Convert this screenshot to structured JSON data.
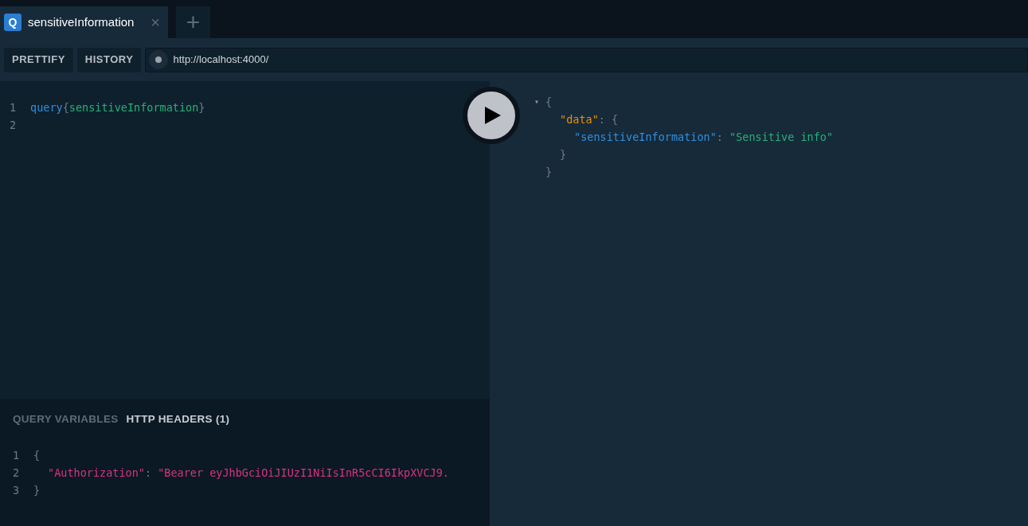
{
  "tabs": [
    {
      "badge": "Q",
      "label": "sensitiveInformation",
      "close": "×",
      "selected": true
    }
  ],
  "new_tab": "+",
  "toolbar": {
    "buttons": [
      "PRETTIFY",
      "HISTORY"
    ],
    "url": "http://localhost:4000/"
  },
  "query_editor": {
    "lines": [
      {
        "number": "1",
        "tokens": [
          {
            "text": "query",
            "kind": "keyword"
          },
          {
            "text": "{",
            "kind": "punct"
          },
          {
            "text": "sensitiveInformation",
            "kind": "field"
          },
          {
            "text": "}",
            "kind": "punct"
          }
        ]
      },
      {
        "number": "2"
      }
    ]
  },
  "bottom_panel": {
    "tabs": [
      {
        "label": "QUERY VARIABLES",
        "selected": false
      },
      {
        "label": "HTTP HEADERS (1)",
        "selected": true
      }
    ],
    "lines": [
      {
        "number": "1",
        "kind": "outer",
        "tokens": [
          {
            "text": "{",
            "kind": "punct"
          }
        ]
      },
      {
        "number": "2",
        "kind": "inner",
        "tokens": [
          {
            "text": "\"Authorization\"",
            "kind": "header"
          },
          {
            "text": ": ",
            "kind": "punct"
          },
          {
            "text": "\"Bearer eyJhbGciOiJIUzI1NiIsInR5cCI6IkpXVCJ9.",
            "kind": "header"
          }
        ]
      },
      {
        "number": "3",
        "kind": "outer",
        "tokens": [
          {
            "text": "}",
            "kind": "punct"
          }
        ]
      }
    ]
  },
  "result": {
    "lines": [
      {
        "fold": "▾",
        "kind": "outer",
        "tokens": [
          {
            "text": "{",
            "kind": "punct"
          }
        ]
      },
      {
        "kind": "inner",
        "tokens": [
          {
            "text": "\"data\"",
            "kind": "key"
          },
          {
            "text": ": {",
            "kind": "punct"
          }
        ]
      },
      {
        "kind": "deep",
        "tokens": [
          {
            "text": "\"sensitiveInformation\"",
            "kind": "prop"
          },
          {
            "text": ": ",
            "kind": "punct"
          },
          {
            "text": "\"Sensitive info\"",
            "kind": "string"
          }
        ]
      },
      {
        "kind": "inner",
        "tokens": [
          {
            "text": "}",
            "kind": "punct"
          }
        ]
      },
      {
        "kind": "outer",
        "tokens": [
          {
            "text": "}",
            "kind": "punct"
          }
        ]
      }
    ]
  }
}
